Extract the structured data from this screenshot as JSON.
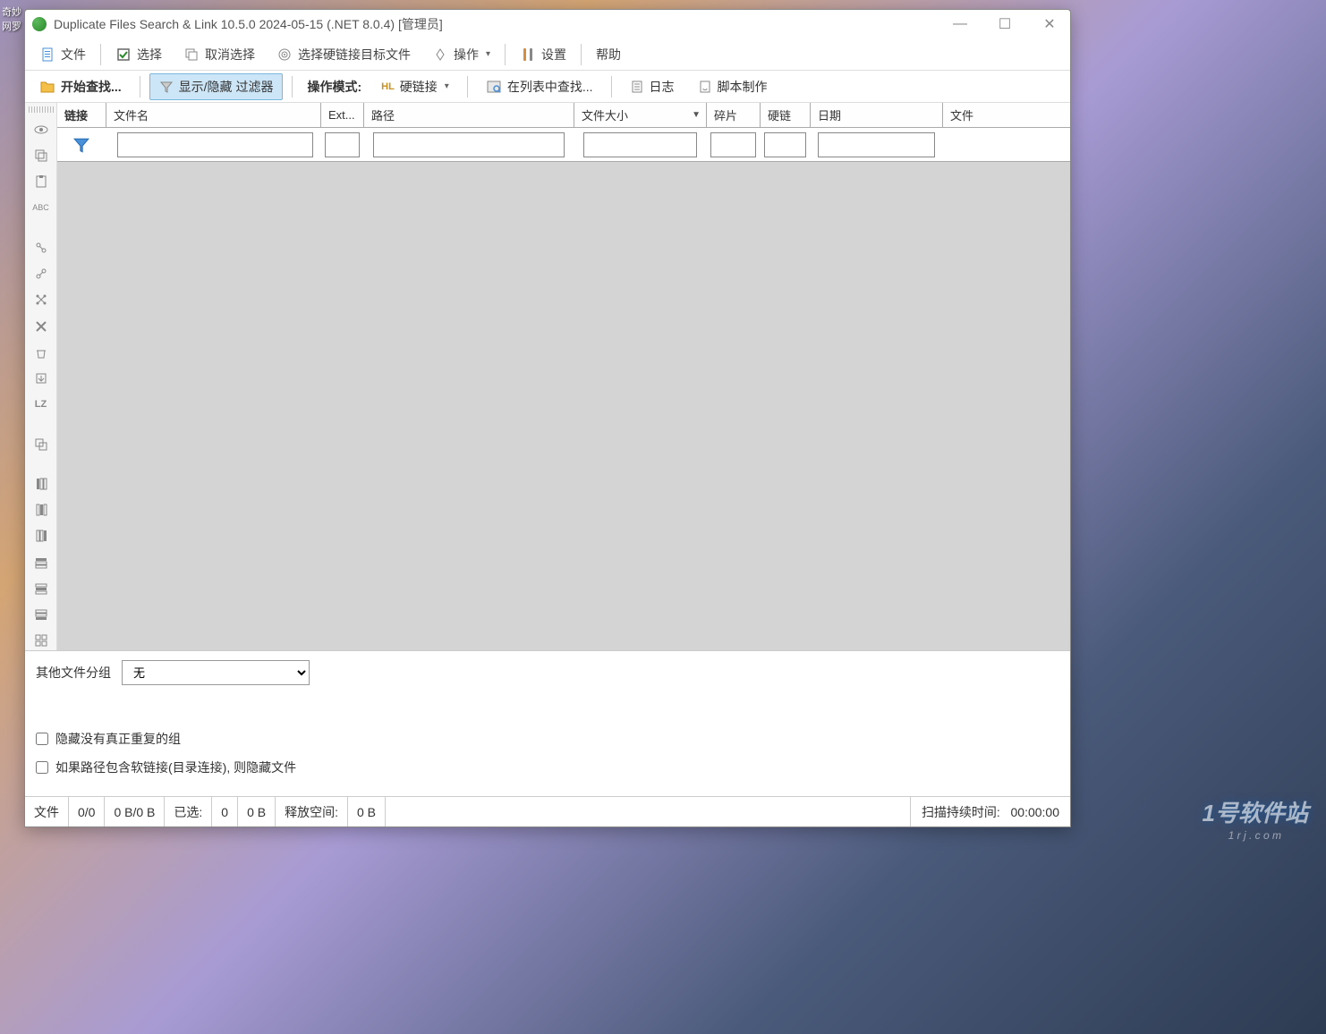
{
  "window": {
    "title": "Duplicate Files Search & Link 10.5.0 2024-05-15 (.NET 8.0.4) [管理员]"
  },
  "menubar": {
    "file": "文件",
    "select": "选择",
    "deselect": "取消选择",
    "select_hardlink_target": "选择硬链接目标文件",
    "operate": "操作",
    "settings": "设置",
    "help": "帮助"
  },
  "toolbar": {
    "start_search": "开始查找...",
    "show_hide_filter": "显示/隐藏 过滤器",
    "mode_label": "操作模式:",
    "hardlink": "硬链接",
    "search_in_list": "在列表中查找...",
    "log": "日志",
    "script": "脚本制作"
  },
  "columns": {
    "link": "链接",
    "filename": "文件名",
    "ext": "Ext...",
    "path": "路径",
    "size": "文件大小",
    "fragment": "碎片",
    "hardlink": "硬链",
    "date": "日期",
    "file": "文件"
  },
  "bottom": {
    "grouping_label": "其他文件分组",
    "grouping_value": "无",
    "cb_hide_no_dup": "隐藏没有真正重复的组",
    "cb_hide_softlink": "如果路径包含软链接(目录连接), 则隐藏文件"
  },
  "statusbar": {
    "file_label": "文件",
    "file_count": "0/0",
    "size": "0 B/0 B",
    "selected_label": "已选:",
    "selected_count": "0",
    "selected_size": "0 B",
    "free_label": "释放空间:",
    "free_size": "0 B",
    "scan_label": "扫描持续时间:",
    "scan_time": "00:00:00"
  },
  "watermark": {
    "main": "1号软件站",
    "sub": "1 r j . c o m"
  },
  "desktop": {
    "top": "奇妙网罗"
  }
}
